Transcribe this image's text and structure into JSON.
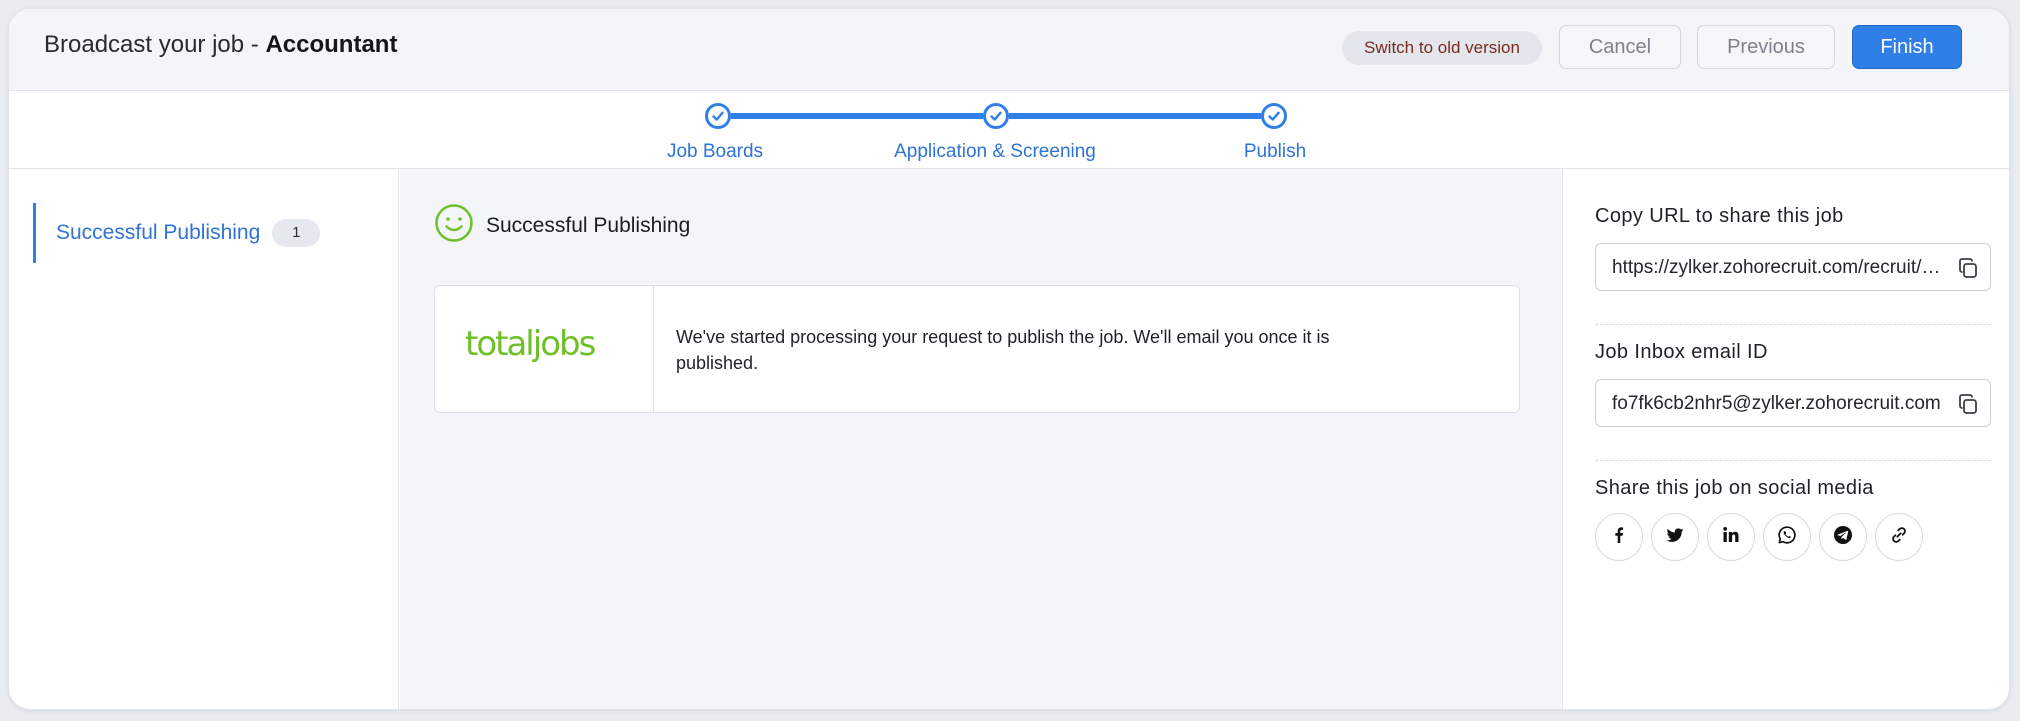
{
  "header": {
    "title_prefix": "Broadcast your job - ",
    "job_name": "Accountant",
    "switch_label": "Switch to old version",
    "cancel_label": "Cancel",
    "previous_label": "Previous",
    "finish_label": "Finish"
  },
  "stepper": {
    "steps": [
      {
        "label": "Job Boards",
        "status": "completed"
      },
      {
        "label": "Application & Screening",
        "status": "completed"
      },
      {
        "label": "Publish",
        "status": "completed"
      }
    ],
    "accent": "#2f7fe6"
  },
  "sidebar": {
    "items": [
      {
        "label": "Successful Publishing",
        "count": "1",
        "active": true
      }
    ]
  },
  "main": {
    "section_title": "Successful Publishing",
    "section_icon": "smiley-icon",
    "publications": [
      {
        "board_logo_text": "totaljobs",
        "message": "We've started processing your request to publish the job. We'll email you once it is published."
      }
    ],
    "logo_color": "#6fbf2a"
  },
  "share": {
    "url_label": "Copy URL to share this job",
    "url_value": "https://zylker.zohorecruit.com/recruit/ViewJob.na?digest=jobboard",
    "email_label": "Job Inbox email ID",
    "email_value": "fo7fk6cb2nhr5@zylker.zohorecruit.com",
    "social_label": "Share this job on social media",
    "social_icons": [
      "facebook-icon",
      "twitter-icon",
      "linkedin-icon",
      "whatsapp-icon",
      "telegram-icon",
      "link-icon"
    ]
  }
}
